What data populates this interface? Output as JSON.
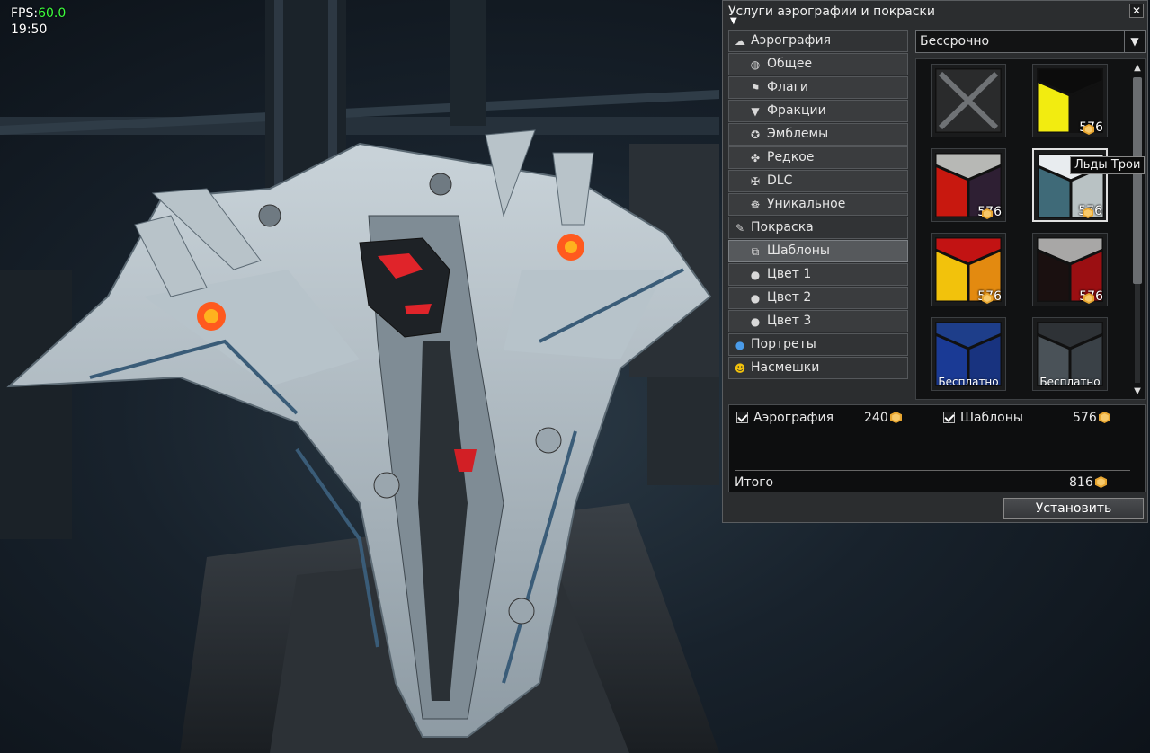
{
  "hud": {
    "fps_label": "FPS:",
    "fps_value": "60.0",
    "time": "19:50"
  },
  "panel": {
    "title": "Услуги аэрографии и покраски",
    "close_label": "✕"
  },
  "menu": [
    {
      "label": "Аэрография",
      "type": "cat",
      "icon": "cloud-icon"
    },
    {
      "label": "Общее",
      "type": "sub",
      "icon": "globe-icon"
    },
    {
      "label": "Флаги",
      "type": "sub",
      "icon": "flag-icon"
    },
    {
      "label": "Фракции",
      "type": "sub",
      "icon": "faction-icon"
    },
    {
      "label": "Эмблемы",
      "type": "sub",
      "icon": "star-icon"
    },
    {
      "label": "Редкое",
      "type": "sub",
      "icon": "rare-icon"
    },
    {
      "label": "DLC",
      "type": "sub",
      "icon": "dlc-icon"
    },
    {
      "label": "Уникальное",
      "type": "sub",
      "icon": "unique-icon"
    },
    {
      "label": "Покраска",
      "type": "cat",
      "icon": "brush-icon"
    },
    {
      "label": "Шаблоны",
      "type": "sub",
      "icon": "template-icon",
      "selected": true
    },
    {
      "label": "Цвет 1",
      "type": "sub",
      "icon": "drop-1-icon"
    },
    {
      "label": "Цвет 2",
      "type": "sub",
      "icon": "drop-2-icon"
    },
    {
      "label": "Цвет 3",
      "type": "sub",
      "icon": "drop-3-icon"
    },
    {
      "label": "Портреты",
      "type": "cat",
      "icon": "person-icon"
    },
    {
      "label": "Насмешки",
      "type": "cat",
      "icon": "smiley-icon"
    }
  ],
  "dropdown": {
    "value": "Бессрочно"
  },
  "tiles": [
    {
      "name": "none",
      "price": "",
      "free": "",
      "colors": {
        "top": "#2a2b2c",
        "left": "#2a2b2c",
        "right": "#2a2b2c"
      },
      "empty": true
    },
    {
      "name": "black-yellow",
      "price": "576",
      "free": "",
      "colors": {
        "top": "#0c0c0c",
        "left": "#f2ec10",
        "right": "#111111"
      }
    },
    {
      "name": "grey-red-purple",
      "price": "576",
      "free": "",
      "colors": {
        "top": "#b7b8b5",
        "left": "#c8180f",
        "right": "#2e1f33"
      }
    },
    {
      "name": "white-teal",
      "price": "576",
      "free": "",
      "colors": {
        "top": "#e8ecef",
        "left": "#3f6a78",
        "right": "#b9c2c4"
      },
      "selected": true
    },
    {
      "name": "red-yellow-orange",
      "price": "576",
      "free": "",
      "colors": {
        "top": "#c21313",
        "left": "#f2c20c",
        "right": "#e38a10"
      }
    },
    {
      "name": "grey-black-red",
      "price": "576",
      "free": "",
      "colors": {
        "top": "#a8a7a6",
        "left": "#1a1010",
        "right": "#9b0f12"
      }
    },
    {
      "name": "blue",
      "price": "",
      "free": "Бесплатно",
      "colors": {
        "top": "#1e3e8a",
        "left": "#1a3a95",
        "right": "#18337f"
      }
    },
    {
      "name": "dark-grey",
      "price": "",
      "free": "Бесплатно",
      "colors": {
        "top": "#2e3236",
        "left": "#4a5258",
        "right": "#3a4147"
      }
    }
  ],
  "tooltip": {
    "text": "Льды Трои"
  },
  "summary": {
    "item1_label": "Аэрография",
    "item1_price": "240",
    "item2_label": "Шаблоны",
    "item2_price": "576",
    "total_label": "Итого",
    "total_price": "816"
  },
  "install_label": "Установить",
  "colors": {
    "coin": "#e8a631",
    "accent": "#3cff3c"
  }
}
